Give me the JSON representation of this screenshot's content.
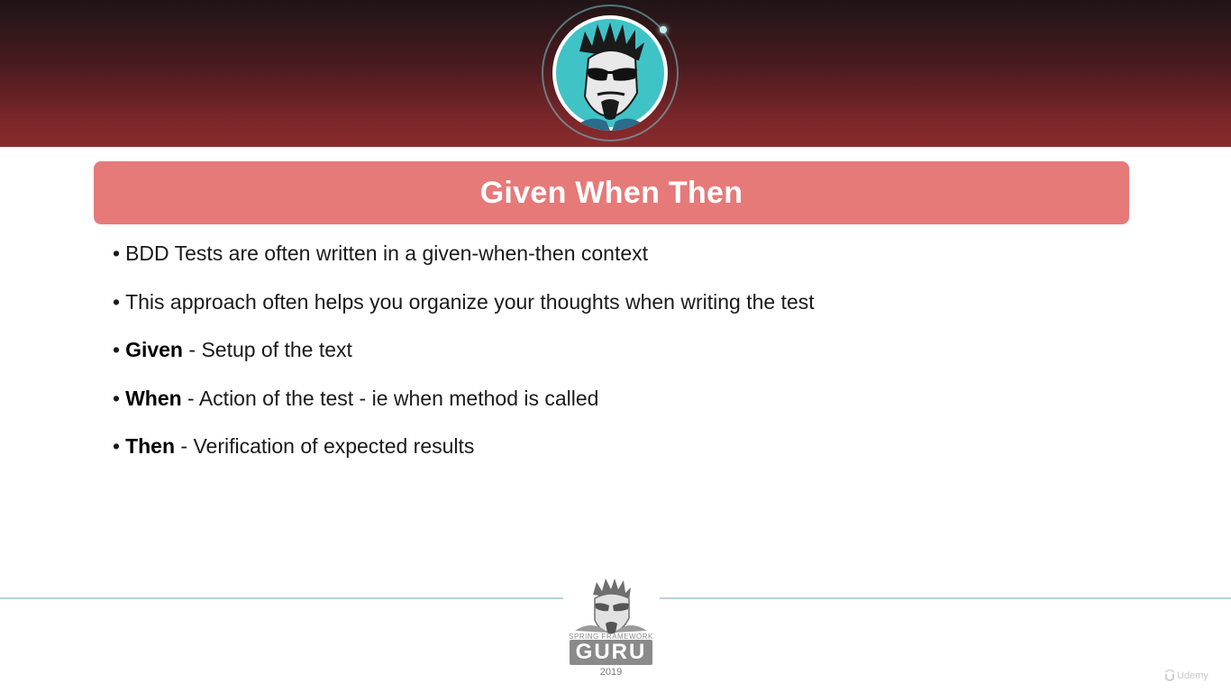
{
  "slide": {
    "title": "Given When Then",
    "bullets": [
      {
        "strong": "",
        "sep": "",
        "text": "BDD Tests are often written in a given-when-then context"
      },
      {
        "strong": "",
        "sep": "",
        "text": "This approach often helps you organize your thoughts when writing the test"
      },
      {
        "strong": "Given",
        "sep": " - ",
        "text": "Setup of the text"
      },
      {
        "strong": "When",
        "sep": " - ",
        "text": "Action of the test - ie when method is called"
      },
      {
        "strong": "Then",
        "sep": " - ",
        "text": "Verification of expected results"
      }
    ]
  },
  "footer": {
    "logo_tagline": "SPRING FRAMEWORK",
    "logo_word": "GURU",
    "year": "2019"
  },
  "watermark": {
    "text": "Udemy",
    "icon": "udemy-logo-icon"
  },
  "icons": {
    "header_avatar": "guru-avatar-icon",
    "footer_avatar": "guru-avatar-small-icon"
  },
  "colors": {
    "header_dark": "#1f1416",
    "header_red": "#8a2b2d",
    "title_bar": "#e57a79",
    "avatar_teal": "#3fc3c7",
    "divider": "#b9d3dc"
  }
}
